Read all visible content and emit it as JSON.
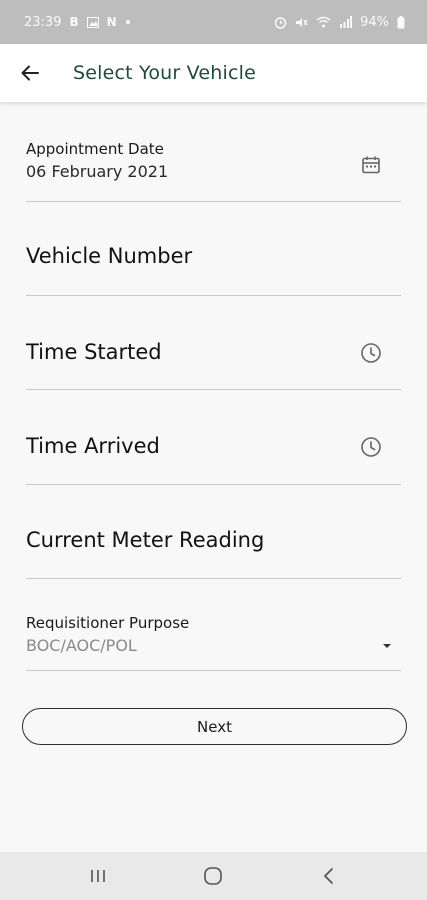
{
  "status_bar": {
    "time": "23:39",
    "left_icons": [
      "b-notification-icon",
      "gallery-notification-icon",
      "n-notification-icon",
      "dot-icon"
    ],
    "battery": "94%",
    "right_icons": [
      "alarm-icon",
      "mute-icon",
      "wifi-icon",
      "signal-icon",
      "battery-icon"
    ]
  },
  "app_bar": {
    "title": "Select Your Vehicle",
    "back_icon": "arrow-left-icon",
    "title_color": "#1d4b3c"
  },
  "form": {
    "appointment_date": {
      "label": "Appointment Date",
      "value": "06 February 2021",
      "icon": "calendar-icon"
    },
    "vehicle_number": {
      "placeholder": "Vehicle Number"
    },
    "time_started": {
      "placeholder": "Time Started",
      "icon": "clock-icon"
    },
    "time_arrived": {
      "placeholder": "Time Arrived",
      "icon": "clock-icon"
    },
    "current_meter_reading": {
      "placeholder": "Current Meter Reading"
    },
    "requisitioner_purpose": {
      "label": "Requisitioner Purpose",
      "value": "BOC/AOC/POL",
      "icon": "dropdown-arrow-icon"
    }
  },
  "next_button": {
    "label": "Next"
  },
  "nav_bar": {
    "items": [
      "recent-apps-icon",
      "home-icon",
      "back-icon"
    ]
  }
}
